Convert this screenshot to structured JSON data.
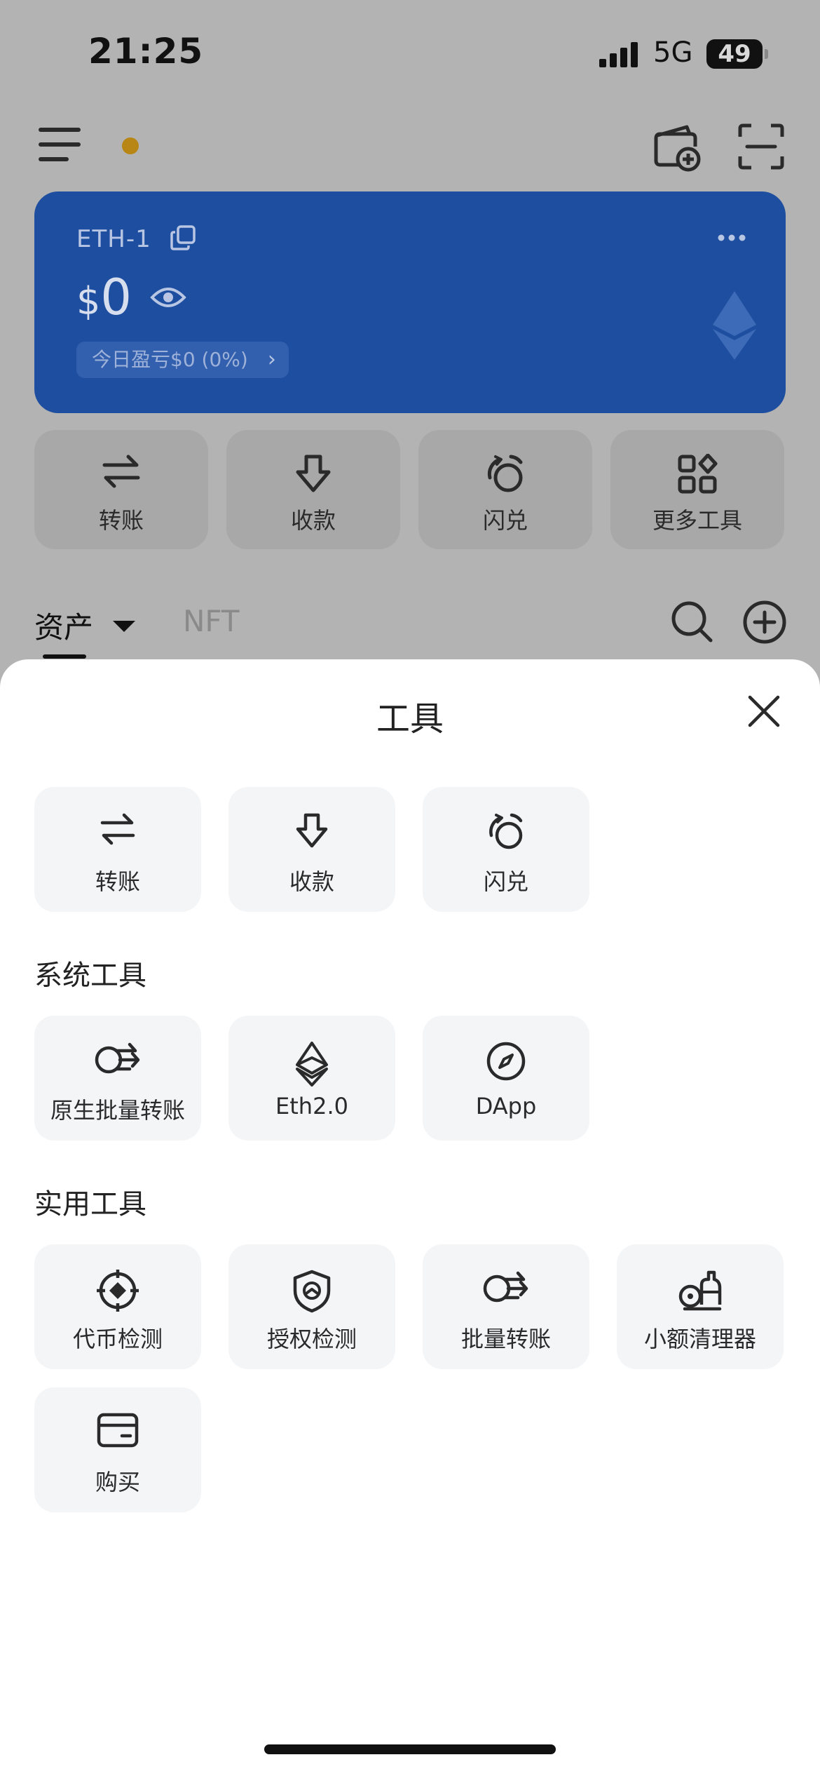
{
  "status_bar": {
    "time": "21:25",
    "network": "5G",
    "battery": "49"
  },
  "wallet_card": {
    "name": "ETH-1",
    "currency_symbol": "$",
    "balance": "0",
    "pnl_text": "今日盈亏$0 (0%)"
  },
  "quick_actions": [
    {
      "label": "转账",
      "icon": "transfer-icon"
    },
    {
      "label": "收款",
      "icon": "receive-icon"
    },
    {
      "label": "闪兑",
      "icon": "swap-icon"
    },
    {
      "label": "更多工具",
      "icon": "more-tools-icon"
    }
  ],
  "tabs": {
    "assets": "资产",
    "nft": "NFT"
  },
  "sheet": {
    "title": "工具",
    "top_tools": [
      {
        "label": "转账",
        "icon": "transfer-icon"
      },
      {
        "label": "收款",
        "icon": "receive-icon"
      },
      {
        "label": "闪兑",
        "icon": "swap-icon"
      }
    ],
    "system_tools": {
      "title": "系统工具",
      "items": [
        {
          "label": "原生批量转账",
          "icon": "batch-transfer-icon"
        },
        {
          "label": "Eth2.0",
          "icon": "ethereum-icon"
        },
        {
          "label": "DApp",
          "icon": "compass-icon"
        }
      ]
    },
    "utility_tools": {
      "title": "实用工具",
      "items": [
        {
          "label": "代币检测",
          "icon": "token-check-icon"
        },
        {
          "label": "授权检测",
          "icon": "shield-check-icon"
        },
        {
          "label": "批量转账",
          "icon": "batch-transfer-icon"
        },
        {
          "label": "小额清理器",
          "icon": "cleaner-icon"
        },
        {
          "label": "购买",
          "icon": "card-icon"
        }
      ]
    }
  },
  "colors": {
    "card_blue": "#1e4ea0",
    "overlay_gray": "#b3b3b3",
    "tile_bg": "#f4f5f7",
    "dot_gold": "#b88614"
  }
}
